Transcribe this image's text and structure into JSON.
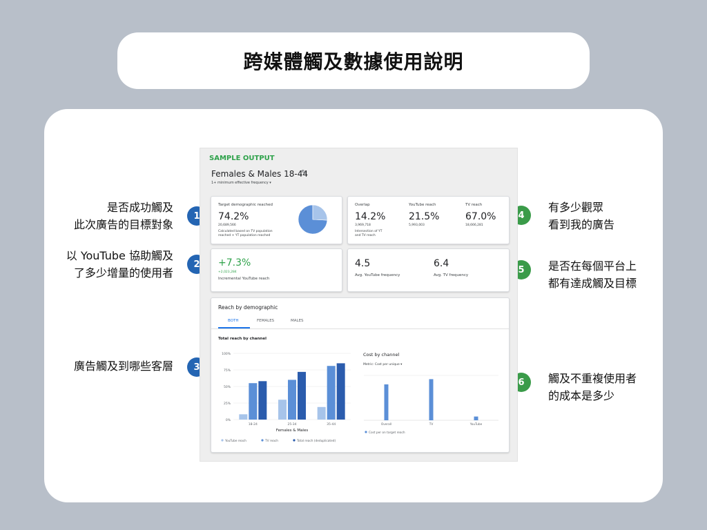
{
  "title": "跨媒體觸及數據使用說明",
  "notes": {
    "n1": [
      "是否成功觸及",
      "此次廣告的目標對象"
    ],
    "n2": [
      "以 YouTube 協助觸及",
      "了多少增量的使用者"
    ],
    "n3": [
      "廣告觸及到哪些客層"
    ],
    "n4": [
      "有多少觀眾",
      "看到我的廣告"
    ],
    "n5": [
      "是否在每個平台上",
      "都有達成觸及目標"
    ],
    "n6": [
      "觸及不重複使用者",
      "的成本是多少"
    ]
  },
  "markers": [
    "1",
    "2",
    "3",
    "4",
    "5",
    "6"
  ],
  "colors": {
    "blue_marker": "#2465b3",
    "green_marker": "#3a9b49",
    "youtube_reach": "#a7c4ea",
    "tv_reach": "#5b8fd7",
    "total_reach": "#2b5cad",
    "sample_label": "#2ea24a",
    "positive": "#2ea24a"
  },
  "report": {
    "sample_label": "SAMPLE OUTPUT",
    "segment": "Females & Males 18-44",
    "frequency_filter": "1+ minimum effective frequency",
    "target": {
      "label": "Target demographic reached",
      "value": "74.2%",
      "count": "20,689,566",
      "note1": "Calculated based on TV population",
      "note2": "reached + YT population reached"
    },
    "overlap": {
      "label": "Overlap",
      "value": "14.2%",
      "count": "3,969,718",
      "note1": "Intersection of YT",
      "note2": "and TV reach"
    },
    "youtube_reach": {
      "label": "YouTube reach",
      "value": "21.5%",
      "count": "5,993,003"
    },
    "tv_reach": {
      "label": "TV reach",
      "value": "67.0%",
      "count": "18,666,281"
    },
    "incremental": {
      "value": "+7.3%",
      "count": "+2,023,284",
      "label": "Incremental YouTube reach"
    },
    "avg_youtube_freq": {
      "value": "4.5",
      "label": "Avg. YouTube frequency"
    },
    "avg_tv_freq": {
      "value": "6.4",
      "label": "Avg. TV frequency"
    },
    "demo": {
      "title": "Reach by demographic",
      "tabs": [
        "BOTH",
        "FEMALES",
        "MALES"
      ],
      "total_title": "Total reach by channel",
      "cost_title": "Cost by channel",
      "metric_label": "Metric: Cost per unique"
    }
  },
  "chart_data": [
    {
      "type": "pie",
      "title": "",
      "categories": [
        "Target demographic reached",
        "Not reached"
      ],
      "values": [
        74.2,
        25.8
      ]
    },
    {
      "type": "bar",
      "title": "Total reach by channel",
      "xlabel": "Females & Males",
      "ylabel": "",
      "categories": [
        "18-24",
        "25-34",
        "35-44"
      ],
      "yticks": [
        "0%",
        "25%",
        "50%",
        "75%",
        "100%"
      ],
      "ylim": [
        0,
        100
      ],
      "series": [
        {
          "name": "YouTube reach",
          "values": [
            8,
            30,
            19
          ]
        },
        {
          "name": "TV reach",
          "values": [
            55,
            60,
            81
          ]
        },
        {
          "name": "Total reach (deduplicated)",
          "values": [
            58,
            72,
            85
          ]
        }
      ],
      "legend": "bottom"
    },
    {
      "type": "bar",
      "title": "Cost by channel",
      "categories": [
        "Overall",
        "TV",
        "YouTube"
      ],
      "series": [
        {
          "name": "Cost per on target reach",
          "values": [
            48,
            55,
            5
          ]
        }
      ],
      "legend": "bottom"
    }
  ]
}
